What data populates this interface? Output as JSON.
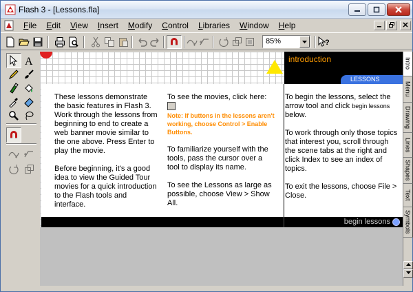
{
  "window": {
    "title": "Flash 3 - [Lessons.fla]"
  },
  "menu": {
    "items": [
      "File",
      "Edit",
      "View",
      "Insert",
      "Modify",
      "Control",
      "Libraries",
      "Window",
      "Help"
    ]
  },
  "toolbar": {
    "zoom_value": "85%"
  },
  "stage": {
    "banner_title": "introduction",
    "banner_tab": "LESSONS",
    "col1_p1": "These lessons demonstrate the basic features in Flash 3. Work through the lessons from beginning to end to create a web banner movie similar to the one above. Press Enter to play the movie.",
    "col1_p2": "Before beginning, it's a good idea to view the Guided Tour movies for a quick introduction to the Flash tools and interface.",
    "col2_p1": "To see the movies, click here:",
    "col2_note": "Note: If  buttons in the lessons aren't working, choose Control > Enable Buttons.",
    "col2_p2": "To familiarize yourself with the tools, pass the cursor over a tool to display its name.",
    "col2_p3": "To see the Lessons as large as possible, choose View > Show All.",
    "col3_p1a": "To begin the lessons, select the arrow tool and click ",
    "col3_p1b": "begin lessons",
    "col3_p1c": " below.",
    "col3_p2": "To work through only those topics that interest you, scroll through the scene tabs at the right and click Index to see an index of topics.",
    "col3_p3": "To exit the lessons, choose File > Close.",
    "begin_lessons": "begin lessons"
  },
  "scene_tabs": [
    "Intro",
    "Menu",
    "Drawing",
    "Lines",
    "Shapes",
    "Text",
    "Symbols"
  ],
  "colors": {
    "accent_orange": "#ff8c00",
    "banner_black": "#000000",
    "tab_blue": "#3a72e0"
  }
}
